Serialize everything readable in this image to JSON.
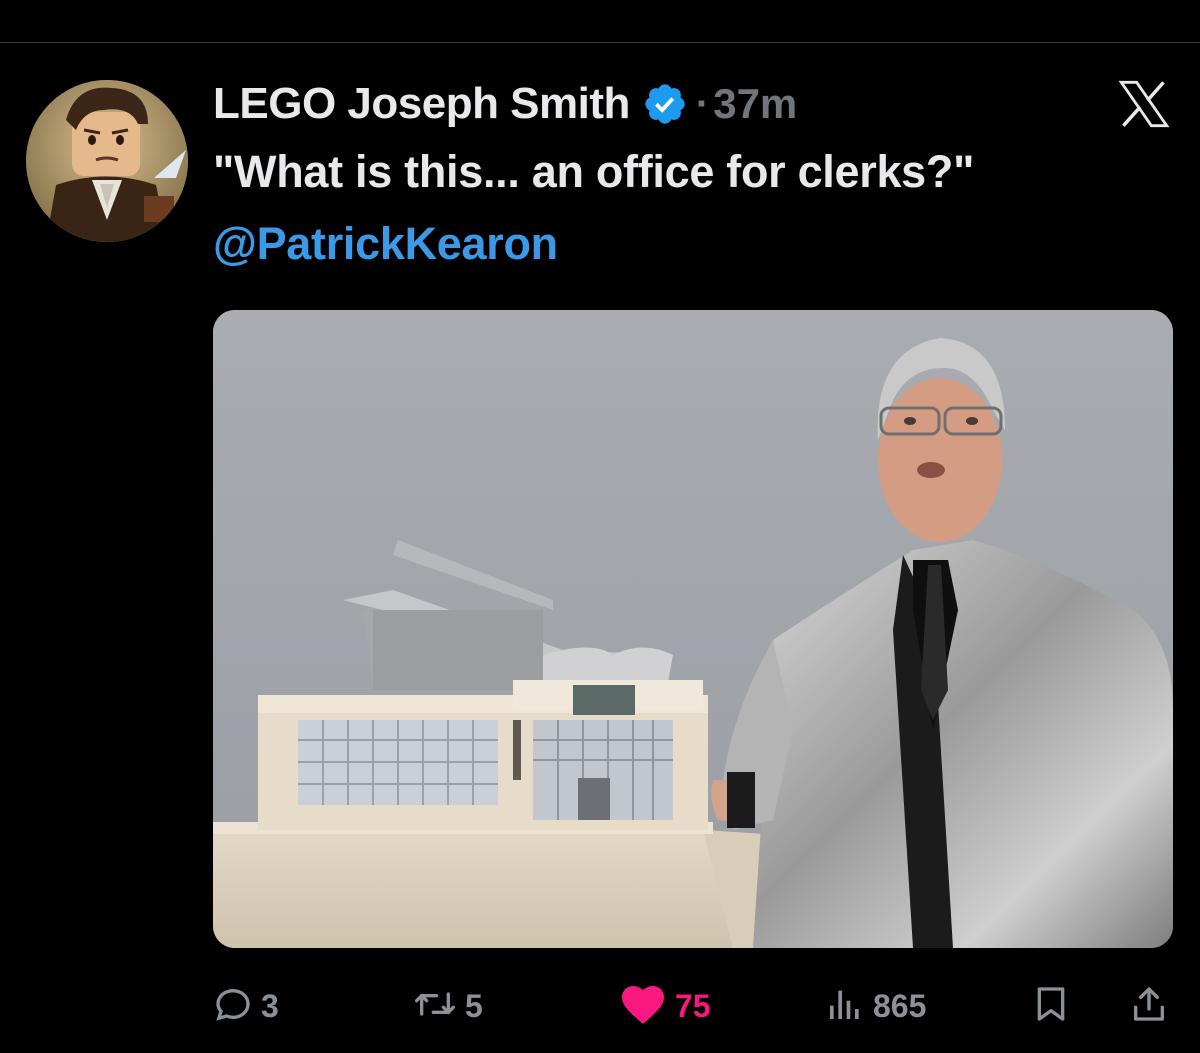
{
  "tweet": {
    "display_name": "LEGO Joseph Smith",
    "separator": "·",
    "time": "37m",
    "text": "\"What is this... an office for clerks?\"",
    "mention": "@PatrickKearon"
  },
  "actions": {
    "replies": "3",
    "reposts": "5",
    "likes": "75",
    "views": "865"
  },
  "colors": {
    "background": "#000000",
    "text_primary": "#e7e9ea",
    "text_secondary": "#71767b",
    "link_blue": "#3b9ae8",
    "verified_blue": "#1d9bf0",
    "like_pink": "#f91880"
  },
  "icons": {
    "verified": "verified-badge-icon",
    "brand": "x-logo-icon",
    "reply": "reply-icon",
    "repost": "repost-icon",
    "like": "heart-icon",
    "views": "views-icon",
    "bookmark": "bookmark-icon",
    "share": "share-icon"
  }
}
